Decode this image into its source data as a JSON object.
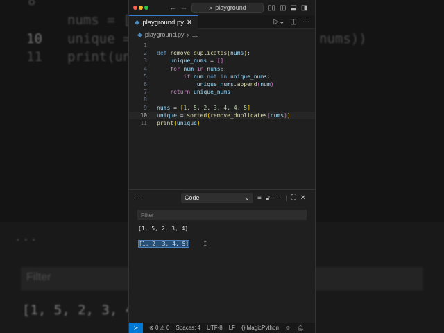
{
  "background": {
    "lines": [
      "8",
      "nums = [",
      "10",
      "unique =",
      "11",
      "print(uni",
      "nums))"
    ],
    "more": "···",
    "filter": "Filter",
    "output": "[1, 5, 2, 3, 4]"
  },
  "titlebar": {
    "search": "playground"
  },
  "tab": {
    "label": "playground.py"
  },
  "breadcrumb": {
    "file": "playground.py",
    "rest": "…"
  },
  "code": [
    {
      "n": "1",
      "html": ""
    },
    {
      "n": "2",
      "html": "<span class='kw'>def</span> <span class='fn'>remove_duplicates</span><span class='br'>(</span><span class='vr'>nums</span><span class='br'>)</span>:"
    },
    {
      "n": "3",
      "html": "    <span class='vr'>unique_nums</span> = <span class='br2'>[]</span>"
    },
    {
      "n": "4",
      "html": "    <span class='kw2'>for</span> <span class='vr'>num</span> <span class='kw2'>in</span> <span class='vr'>nums</span>:"
    },
    {
      "n": "5",
      "html": "        <span class='kw2'>if</span> <span class='vr'>num</span> <span class='kw'>not in</span> <span class='vr'>unique_nums</span>:"
    },
    {
      "n": "6",
      "html": "            <span class='vr'>unique_nums</span>.<span class='fn'>append</span><span class='br2'>(</span><span class='vr'>num</span><span class='br2'>)</span>"
    },
    {
      "n": "7",
      "html": "    <span class='kw2'>return</span> <span class='vr'>unique_nums</span>"
    },
    {
      "n": "8",
      "html": ""
    },
    {
      "n": "9",
      "html": "<span class='vr'>nums</span> = <span class='br'>[</span><span class='nb'>1</span>, <span class='nb'>5</span>, <span class='nb'>2</span>, <span class='nb'>3</span>, <span class='nb'>4</span>, <span class='nb'>4</span>, <span class='nb'>5</span><span class='br'>]</span>"
    },
    {
      "n": "10",
      "html": "<span class='vr'>unique</span> = <span class='fn'>sorted</span><span class='br'>(</span><span class='fn'>remove_duplicates</span><span class='br2'>(</span><span class='vr'>nums</span><span class='br2'>)</span><span class='br'>)</span>"
    },
    {
      "n": "11",
      "html": "<span class='fn'>print</span><span class='br'>(</span><span class='vr'>unique</span><span class='br'>)</span>"
    }
  ],
  "panel": {
    "more": "···",
    "dropdown": "Code",
    "filter_placeholder": "Filter",
    "output": [
      "[1, 5, 2, 3, 4]",
      "[1, 2, 3, 4, 5]"
    ]
  },
  "status": {
    "errors": "0",
    "warnings": "0",
    "spaces": "Spaces: 4",
    "encoding": "UTF-8",
    "eol": "LF",
    "language": "MagicPython"
  }
}
